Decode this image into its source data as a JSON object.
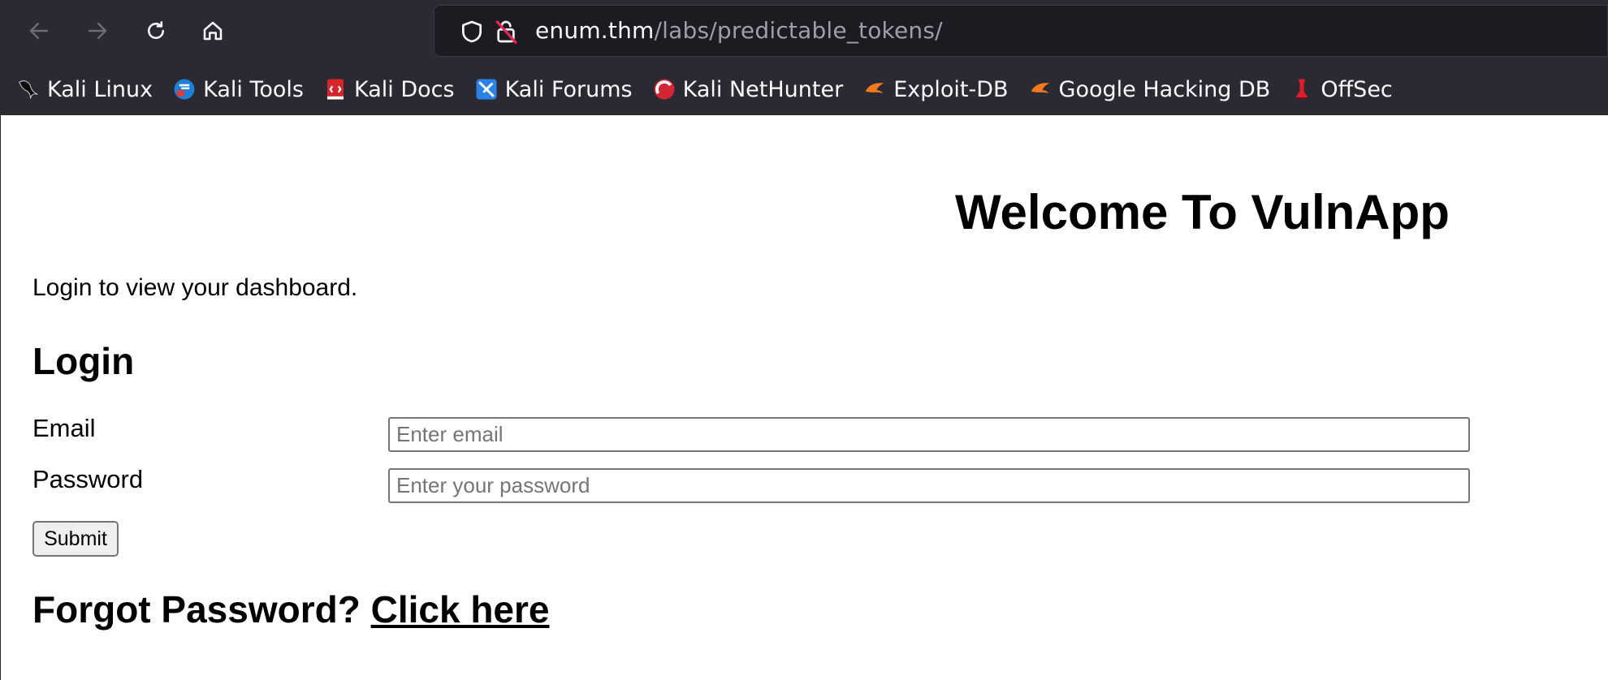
{
  "browser": {
    "url_host": "enum.thm",
    "url_path": "/labs/predictable_tokens/",
    "nav": {
      "back_icon": "arrow-left-icon",
      "forward_icon": "arrow-right-icon",
      "reload_icon": "reload-icon",
      "home_icon": "home-icon"
    },
    "bookmarks": [
      {
        "label": "Kali Linux",
        "icon": "kali-dragon-icon"
      },
      {
        "label": "Kali Tools",
        "icon": "kali-tools-icon"
      },
      {
        "label": "Kali Docs",
        "icon": "kali-docs-icon"
      },
      {
        "label": "Kali Forums",
        "icon": "kali-forums-icon"
      },
      {
        "label": "Kali NetHunter",
        "icon": "kali-nethunter-icon"
      },
      {
        "label": "Exploit-DB",
        "icon": "exploit-db-icon"
      },
      {
        "label": "Google Hacking DB",
        "icon": "ghdb-icon"
      },
      {
        "label": "OffSec",
        "icon": "offsec-icon"
      }
    ],
    "colors": {
      "chrome": "#2b2a33",
      "urlbar": "#1c1b22"
    }
  },
  "page": {
    "heading": "Welcome To VulnApp",
    "intro": "Login to view your dashboard.",
    "login_title": "Login",
    "email_label": "Email",
    "email_placeholder": "Enter email",
    "password_label": "Password",
    "password_placeholder": "Enter your password",
    "submit_label": "Submit",
    "forgot_text": "Forgot Password?",
    "forgot_link": "Click here"
  }
}
